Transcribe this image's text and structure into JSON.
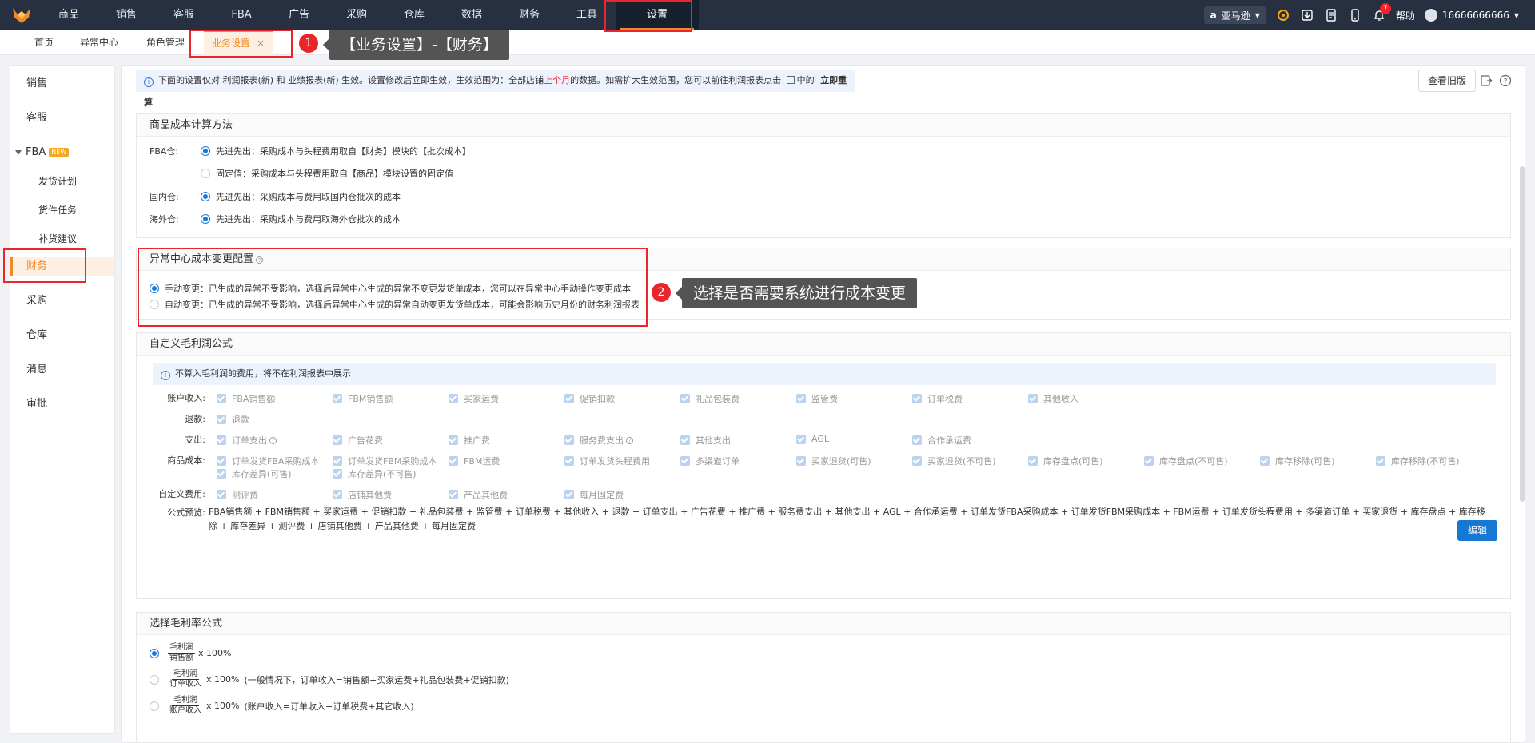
{
  "nav": [
    "商品",
    "销售",
    "客服",
    "FBA",
    "广告",
    "采购",
    "仓库",
    "数据",
    "财务",
    "工具",
    "设置"
  ],
  "top": {
    "site": "亚马逊",
    "site_a": "a",
    "notif_count": "7",
    "help": "帮助",
    "user": "16666666666"
  },
  "tabs": {
    "home": "首页",
    "exception": "异常中心",
    "roles": "角色管理",
    "biz": "业务设置",
    "close": "×"
  },
  "callouts": [
    {
      "num": "1",
      "text": "【业务设置】-【财务】"
    },
    {
      "num": "2",
      "text": "选择是否需要系统进行成本变更"
    }
  ],
  "sidebar": {
    "sales": "销售",
    "service": "客服",
    "fba": "FBA",
    "new": "NEW",
    "ship_plan": "发货计划",
    "cargo": "货件任务",
    "restock": "补货建议",
    "finance": "财务",
    "purchase": "采购",
    "warehouse": "仓库",
    "message": "消息",
    "approval": "审批"
  },
  "notice": {
    "p1": "下面的设置仅对 利润报表(新) 和 业绩报表(新) 生效。设置修改后立即生效，生效范围为：全部店铺",
    "month": "上个月",
    "p2": "的数据。如需扩大生效范围，您可以前往利润报表点击",
    "p3": "中的",
    "recalc": "立即重算",
    "old_btn": "查看旧版"
  },
  "cost": {
    "title": "商品成本计算方法",
    "fba_label": "FBA仓:",
    "fba_fifo": "先进先出：采购成本与头程费用取自【财务】模块的【批次成本】",
    "fba_fixed": "固定值：采购成本与头程费用取自【商品】模块设置的固定值",
    "domestic_label": "国内仓:",
    "domestic_fifo": "先进先出：采购成本与费用取国内仓批次的成本",
    "overseas_label": "海外仓:",
    "overseas_fifo": "先进先出：采购成本与费用取海外仓批次的成本"
  },
  "exc": {
    "title": "异常中心成本变更配置",
    "manual": "手动变更：已生成的异常不受影响，选择后异常中心生成的异常不变更发货单成本，您可以在异常中心手动操作变更成本",
    "auto": "自动变更：已生成的异常不受影响，选择后异常中心生成的异常自动变更发货单成本，可能会影响历史月份的财务利润报表"
  },
  "profit": {
    "title": "自定义毛利润公式",
    "tip": "不算入毛利润的费用，将不在利润报表中展示",
    "labels": {
      "income": "账户收入:",
      "refund": "退款:",
      "expense": "支出:",
      "goods": "商品成本:",
      "custom": "自定义费用:"
    },
    "income": [
      "FBA销售额",
      "FBM销售额",
      "买家运费",
      "促销扣款",
      "礼品包装费",
      "监管费",
      "订单税费",
      "其他收入"
    ],
    "refund": [
      "退款"
    ],
    "expense": [
      "订单支出",
      "广告花费",
      "推广费",
      "服务费支出",
      "其他支出",
      "AGL",
      "合作承运费"
    ],
    "goods": [
      "订单发货FBA采购成本",
      "订单发货FBM采购成本",
      "FBM运费",
      "订单发货头程费用",
      "多渠道订单",
      "买家退货(可售)",
      "买家退货(不可售)",
      "库存盘点(可售)",
      "库存盘点(不可售)",
      "库存移除(可售)",
      "库存移除(不可售)",
      "库存差异(可售)",
      "库存差异(不可售)"
    ],
    "custom": [
      "测评费",
      "店铺其他费",
      "产品其他费",
      "每月固定费"
    ],
    "preview_label": "公式预览:",
    "preview": "FBA销售额 + FBM销售额 + 买家运费 + 促销扣款 + 礼品包装费 + 监管费 + 订单税费 + 其他收入 + 退款 + 订单支出 + 广告花费 + 推广费 + 服务费支出 + 其他支出 + AGL + 合作承运费 + 订单发货FBA采购成本 + 订单发货FBM采购成本 + FBM运费 + 订单发货头程费用 + 多渠道订单 + 买家退货 + 库存盘点 + 库存移除 + 库存差异 + 测评费 + 店铺其他费 + 产品其他费 + 每月固定费",
    "edit": "编辑"
  },
  "margin": {
    "title": "选择毛利率公式",
    "num": "毛利润",
    "d1": "销售额",
    "d2": "订单收入",
    "d3": "账户收入",
    "x": "x 100%",
    "n2": "(一般情况下，订单收入=销售额+买家运费+礼品包装费+促销扣款)",
    "n3": "(账户收入=订单收入+订单税费+其它收入)"
  },
  "colors": {
    "accent": "#f08a24",
    "primary": "#1677d4",
    "annotation": "#e8262c",
    "topbar": "#263040"
  }
}
